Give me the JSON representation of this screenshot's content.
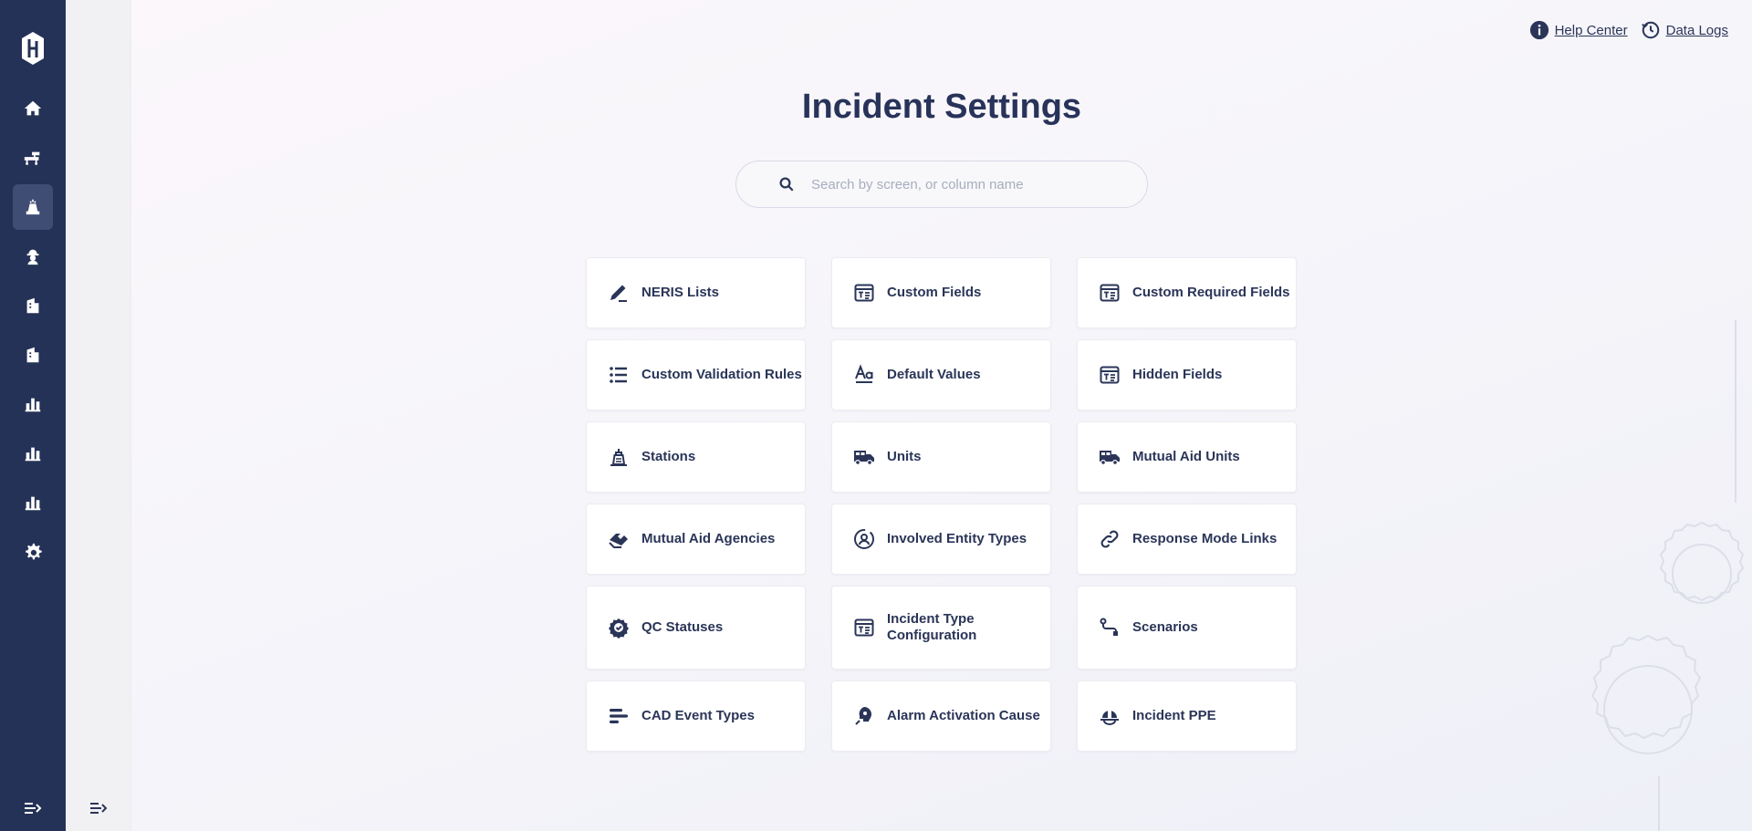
{
  "app": {
    "logo_icon": "brand-logo-icon"
  },
  "rail": {
    "items": [
      {
        "icon": "home-icon",
        "active": false
      },
      {
        "icon": "stretcher-icon",
        "active": false
      },
      {
        "icon": "fire-incident-icon",
        "active": true
      },
      {
        "icon": "firefighter-icon",
        "active": false
      },
      {
        "icon": "building-icon",
        "active": false
      },
      {
        "icon": "building-icon",
        "active": false
      },
      {
        "icon": "bar-chart-icon",
        "active": false
      },
      {
        "icon": "bar-chart-icon",
        "active": false
      },
      {
        "icon": "bar-chart-icon",
        "active": false
      },
      {
        "icon": "gear-icon",
        "active": false
      }
    ]
  },
  "header": {
    "help_center": "Help Center",
    "data_logs": "Data Logs"
  },
  "page": {
    "title": "Incident Settings",
    "search_placeholder": "Search by screen, or column name"
  },
  "cards": [
    {
      "label": "NERIS Lists",
      "icon": "pencil-icon"
    },
    {
      "label": "Custom Fields",
      "icon": "form-icon"
    },
    {
      "label": "Custom Required Fields",
      "icon": "form-icon"
    },
    {
      "label": "Custom Validation Rules",
      "icon": "list-icon"
    },
    {
      "label": "Default Values",
      "icon": "text-format-icon"
    },
    {
      "label": "Hidden Fields",
      "icon": "form-icon"
    },
    {
      "label": "Stations",
      "icon": "station-icon"
    },
    {
      "label": "Units",
      "icon": "truck-icon"
    },
    {
      "label": "Mutual Aid Units",
      "icon": "truck-icon"
    },
    {
      "label": "Mutual Aid Agencies",
      "icon": "handshake-icon"
    },
    {
      "label": "Involved Entity Types",
      "icon": "person-circle-icon"
    },
    {
      "label": "Response Mode Links",
      "icon": "link-icon"
    },
    {
      "label": "QC Statuses",
      "icon": "badge-check-icon"
    },
    {
      "label": "Incident Type Configuration",
      "icon": "form-icon"
    },
    {
      "label": "Scenarios",
      "icon": "route-icon"
    },
    {
      "label": "CAD Event Types",
      "icon": "align-left-icon"
    },
    {
      "label": "Alarm Activation Cause",
      "icon": "alarm-icon"
    },
    {
      "label": "Incident PPE",
      "icon": "helmet-icon"
    }
  ],
  "colors": {
    "rail": "#243257",
    "accent": "#2a3558",
    "active": "#3f4d74"
  }
}
